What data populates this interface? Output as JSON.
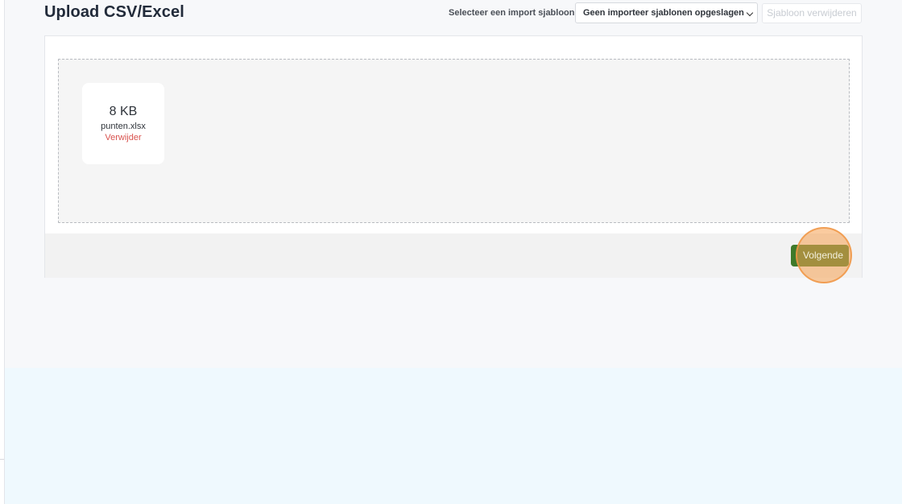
{
  "header": {
    "title": "Upload CSV/Excel",
    "template_label": "Selecteer een import sjabloon",
    "template_select": {
      "selected": "Geen importeer sjablonen opgeslagen",
      "icon": "chevron-down-icon"
    },
    "delete_template_label": "Sjabloon verwijderen"
  },
  "dropzone": {
    "files": [
      {
        "size": "8 KB",
        "name": "punten.xlsx",
        "remove_label": "Verwijder"
      }
    ]
  },
  "footer": {
    "next_label": "Volgende"
  },
  "colors": {
    "accent_green": "#3f7a2a",
    "remove_red": "#d9534f",
    "click_marker": "#f5a050"
  }
}
